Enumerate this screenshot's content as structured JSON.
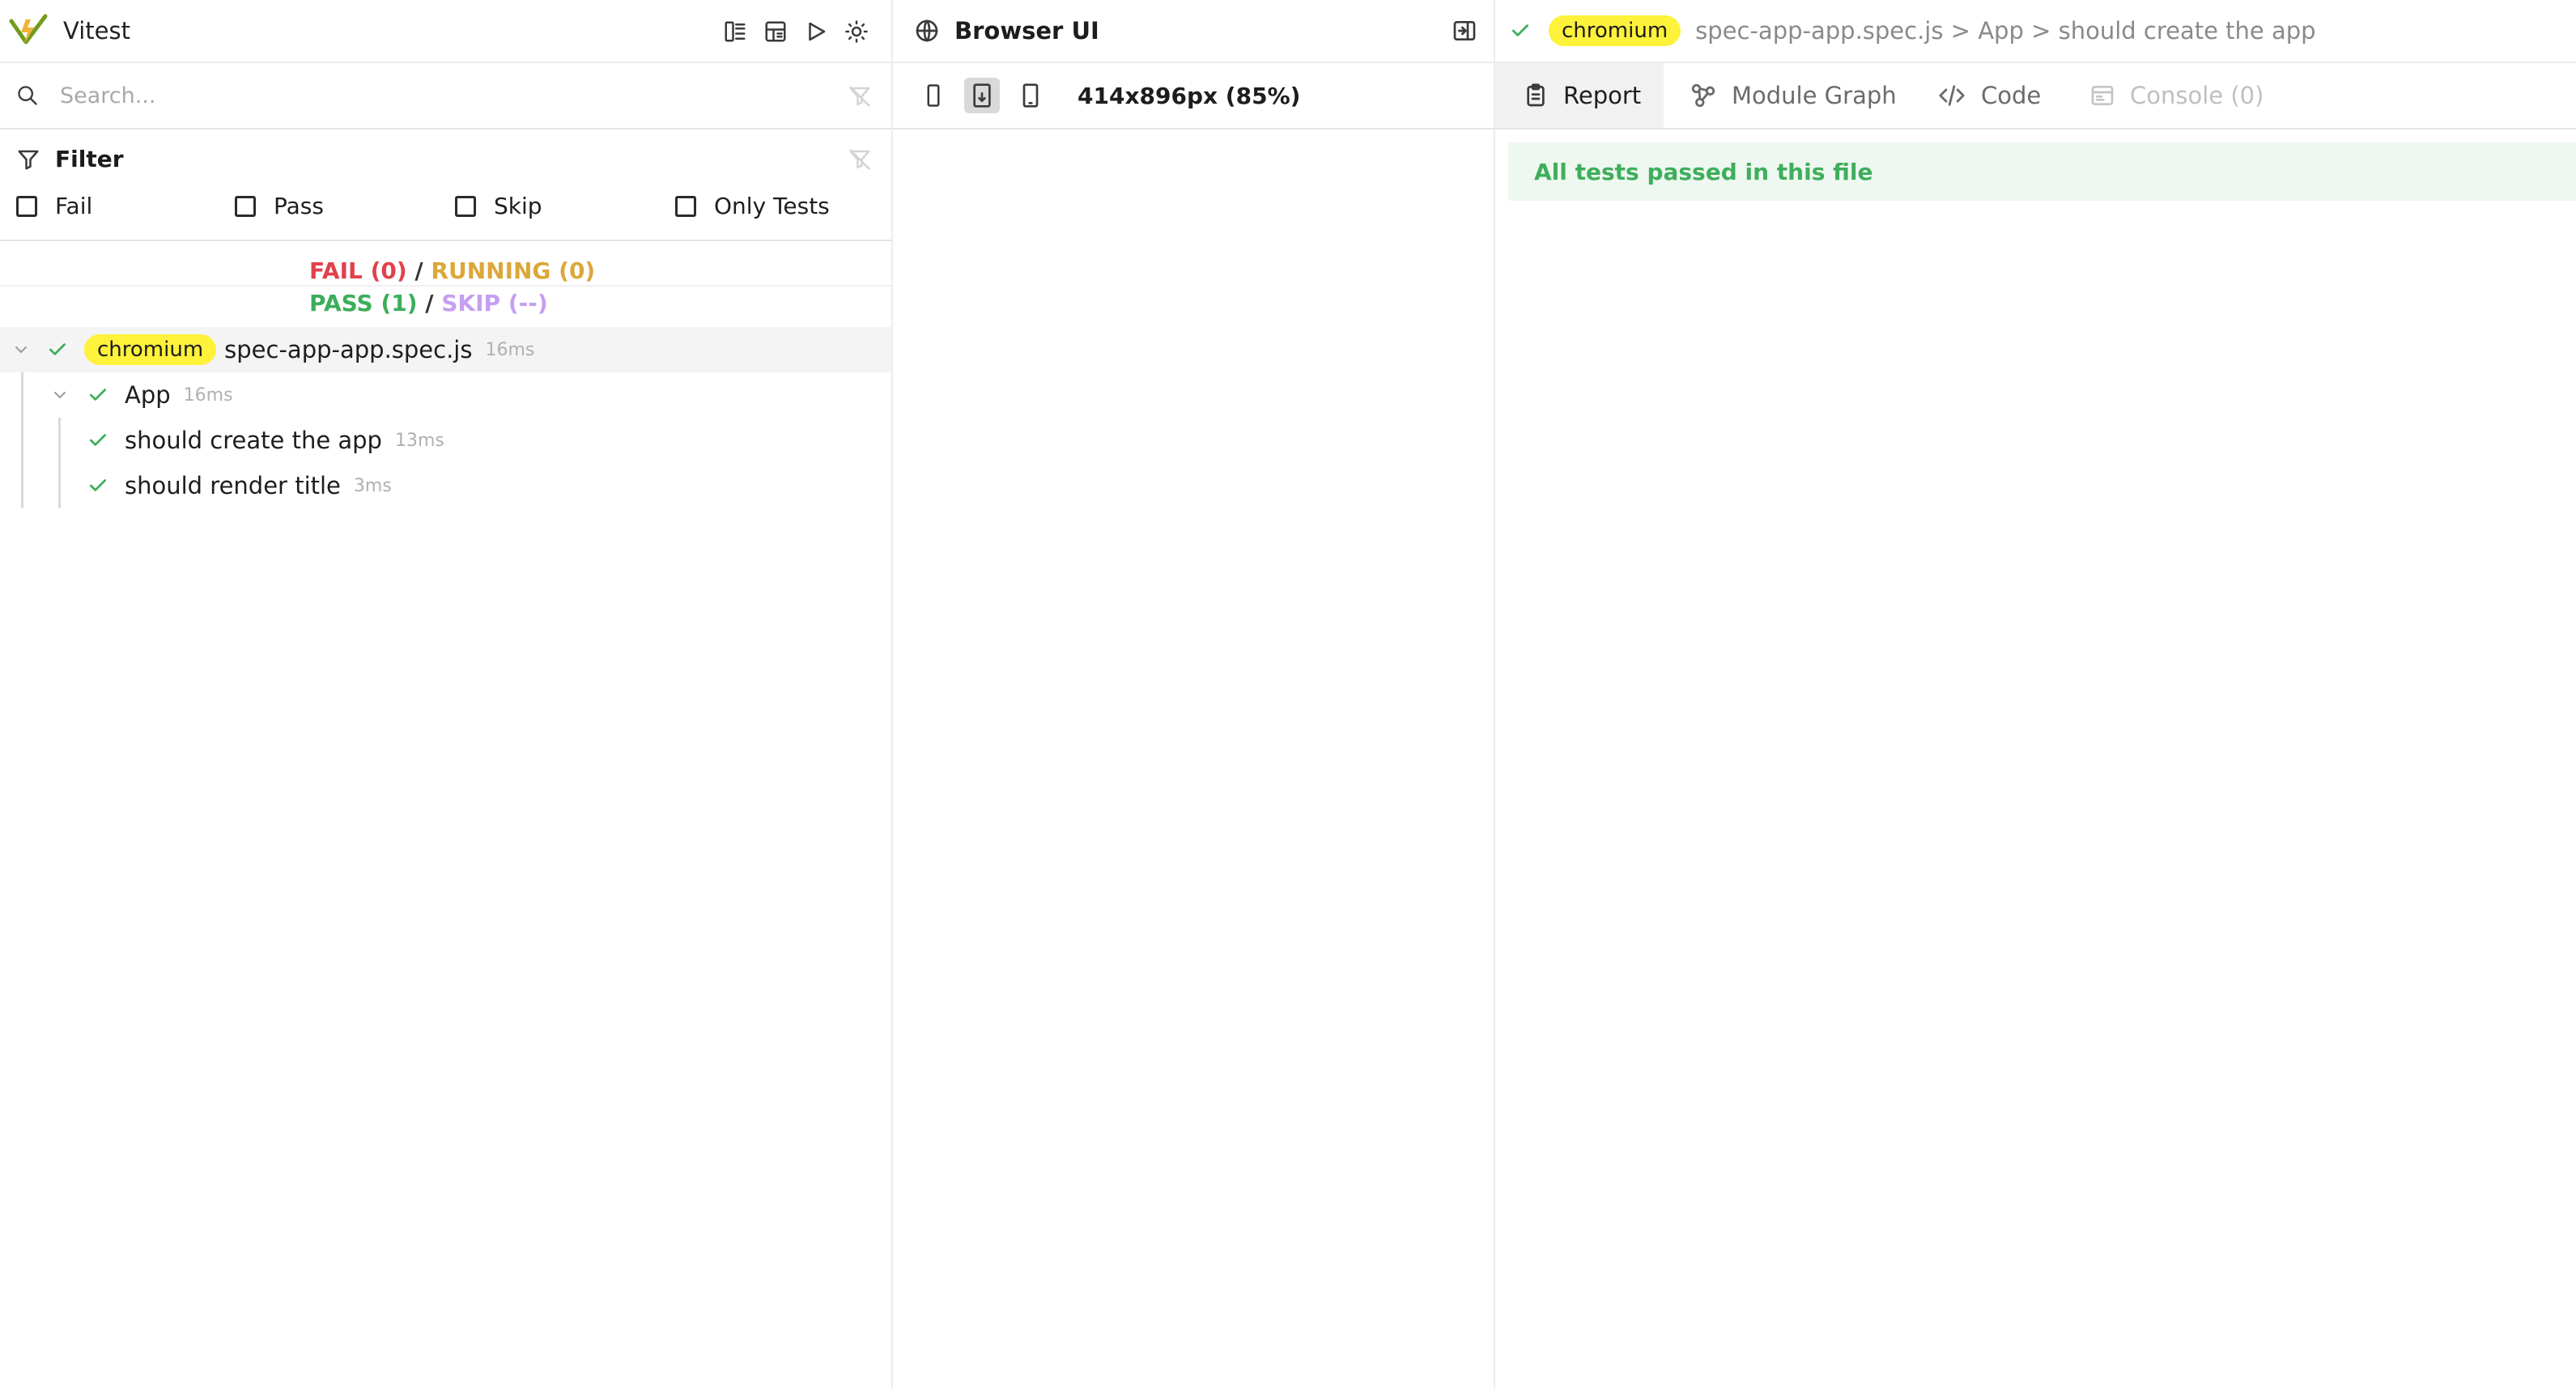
{
  "app": {
    "title": "Vitest",
    "toolbar": [
      "tree-view-icon",
      "dashboard-icon",
      "run-icon",
      "theme-icon"
    ],
    "colors": {
      "brand": "#f2b33a",
      "accent": "#729b1a"
    }
  },
  "search": {
    "placeholder": "Search..."
  },
  "filter": {
    "title": "Filter",
    "options": [
      {
        "label": "Fail",
        "checked": false
      },
      {
        "label": "Pass",
        "checked": false
      },
      {
        "label": "Skip",
        "checked": false
      },
      {
        "label": "Only Tests",
        "checked": false
      }
    ]
  },
  "summary": {
    "fail": "FAIL (0)",
    "running": "RUNNING (0)",
    "pass": "PASS (1)",
    "skip": "SKIP (--)",
    "separator": "/",
    "colors": {
      "fail": "#e2404b",
      "running": "#dca73a",
      "pass": "#3cae5a",
      "skip": "#c59ff0"
    }
  },
  "tree": {
    "file": {
      "badge": "chromium",
      "name": "spec-app-app.spec.js",
      "duration": "16ms",
      "status": "pass"
    },
    "suite": {
      "name": "App",
      "duration": "16ms",
      "status": "pass"
    },
    "tests": [
      {
        "name": "should create the app",
        "duration": "13ms",
        "status": "pass"
      },
      {
        "name": "should render title",
        "duration": "3ms",
        "status": "pass"
      }
    ]
  },
  "browser": {
    "title": "Browser UI",
    "viewport": "414x896px (85%)",
    "devices": [
      "mobile",
      "tablet",
      "responsive"
    ],
    "active_device": "tablet"
  },
  "detail": {
    "badge": "chromium",
    "breadcrumb": "spec-app-app.spec.js > App > should create the app",
    "tabs": [
      {
        "label": "Report",
        "active": true,
        "disabled": false
      },
      {
        "label": "Module Graph",
        "active": false,
        "disabled": false
      },
      {
        "label": "Code",
        "active": false,
        "disabled": false
      },
      {
        "label": "Console (0)",
        "active": false,
        "disabled": true
      }
    ],
    "report_message": "All tests passed in this file"
  }
}
